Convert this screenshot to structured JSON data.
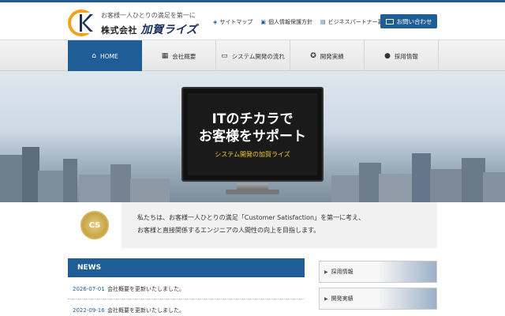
{
  "header": {
    "logo_tagline": "お客様一人ひとりの満足を第一に",
    "logo_company_prefix": "株式会社",
    "logo_company_brand": "加賀ライズ",
    "util_links": [
      {
        "label": "サイトマップ",
        "icon": "sitemap-icon"
      },
      {
        "label": "個人情報保護方針",
        "icon": "lock-icon"
      },
      {
        "label": "ビジネスパートナー募集",
        "icon": "handshake-icon"
      }
    ],
    "contact_label": "お問い合わせ"
  },
  "nav": {
    "items": [
      {
        "label": "HOME",
        "icon": "home-icon"
      },
      {
        "label": "会社概要",
        "icon": "building-icon"
      },
      {
        "label": "システム開発の流れ",
        "icon": "monitor-icon"
      },
      {
        "label": "開発実績",
        "icon": "award-icon"
      },
      {
        "label": "採用情報",
        "icon": "person-icon"
      }
    ]
  },
  "hero": {
    "line1": "ITのチカラで",
    "line2": "お客様をサポート",
    "line3": "システム開発の加賀ライズ"
  },
  "cs": {
    "badge": "CS",
    "line1": "私たちは、お客様一人ひとりの満足「Customer Satisfaction」を第一に考え、",
    "line2": "お客様と直接関係するエンジニアの人間性の向上を目指します。"
  },
  "news": {
    "title": "NEWS",
    "items": [
      {
        "date": "2026-07-01",
        "text": "会社概要を更新いたしました。"
      },
      {
        "date": "2022-09-16",
        "text": "会社概要を更新いたしました。"
      }
    ]
  },
  "side": {
    "banners": [
      {
        "label": "採用情報"
      },
      {
        "label": "開発実績"
      }
    ]
  },
  "colors": {
    "brand": "#1f5d96",
    "accent_gold": "#f3c832"
  }
}
